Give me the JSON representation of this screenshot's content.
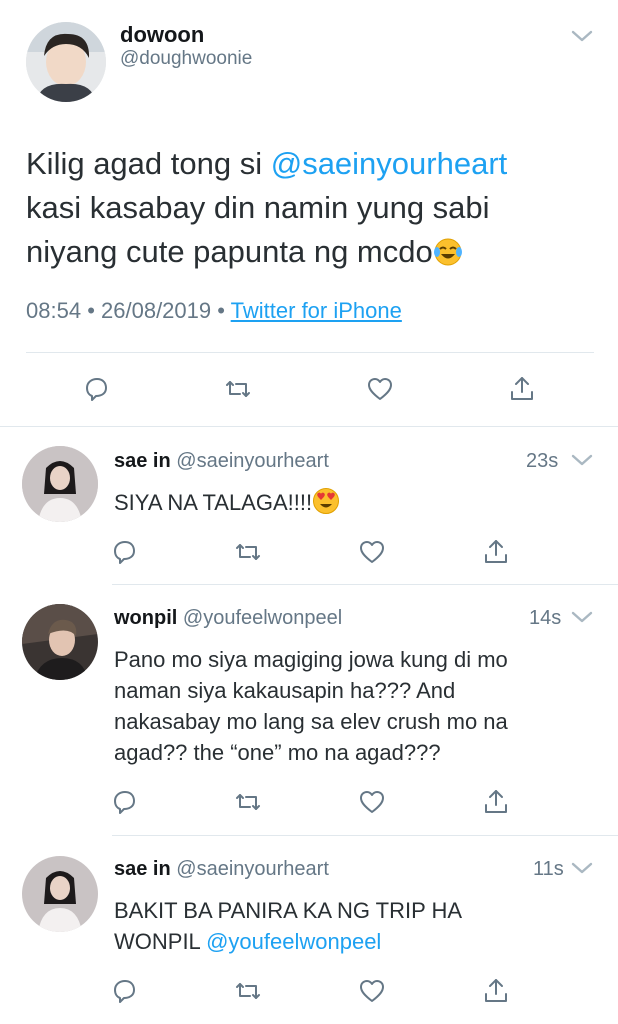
{
  "main_tweet": {
    "author_name": "dowoon",
    "author_handle": "@doughwoonie",
    "text_line1_prefix": "Kilig agad tong si ",
    "text_mention": "@saeinyourheart",
    "text_line2": "kasi kasabay din namin yung sabi",
    "text_line3": "niyang cute papunta ng mcdo",
    "text_emoji": "tears-of-joy-emoji",
    "time": "08:54",
    "date": "26/08/2019",
    "separator": "•",
    "source": "Twitter for iPhone"
  },
  "replies": [
    {
      "name": "sae in",
      "handle": "@saeinyourheart",
      "time": "23s",
      "lines": [
        "SIYA NA TALAGA!!!!"
      ],
      "emoji": "heart-eyes-emoji"
    },
    {
      "name": "wonpil",
      "handle": "@youfeelwonpeel",
      "time": "14s",
      "lines": [
        "Pano mo siya magiging jowa kung di mo",
        "naman siya kakausapin ha??? And",
        "nakasabay mo lang sa elev crush mo na",
        "agad?? the “one” mo na agad???"
      ]
    },
    {
      "name": "sae in",
      "handle": "@saeinyourheart",
      "time": "11s",
      "line1": "BAKIT BA PANIRA KA NG TRIP HA",
      "line2_prefix": "WONPIL ",
      "line2_mention": "@youfeelwonpeel"
    }
  ],
  "icons": {
    "reply": "reply-icon",
    "retweet": "retweet-icon",
    "like": "like-icon",
    "share": "share-icon",
    "caret": "chevron-down-icon"
  },
  "colors": {
    "link": "#1da1f2",
    "muted": "#657786",
    "divider": "#e1e8ed"
  }
}
